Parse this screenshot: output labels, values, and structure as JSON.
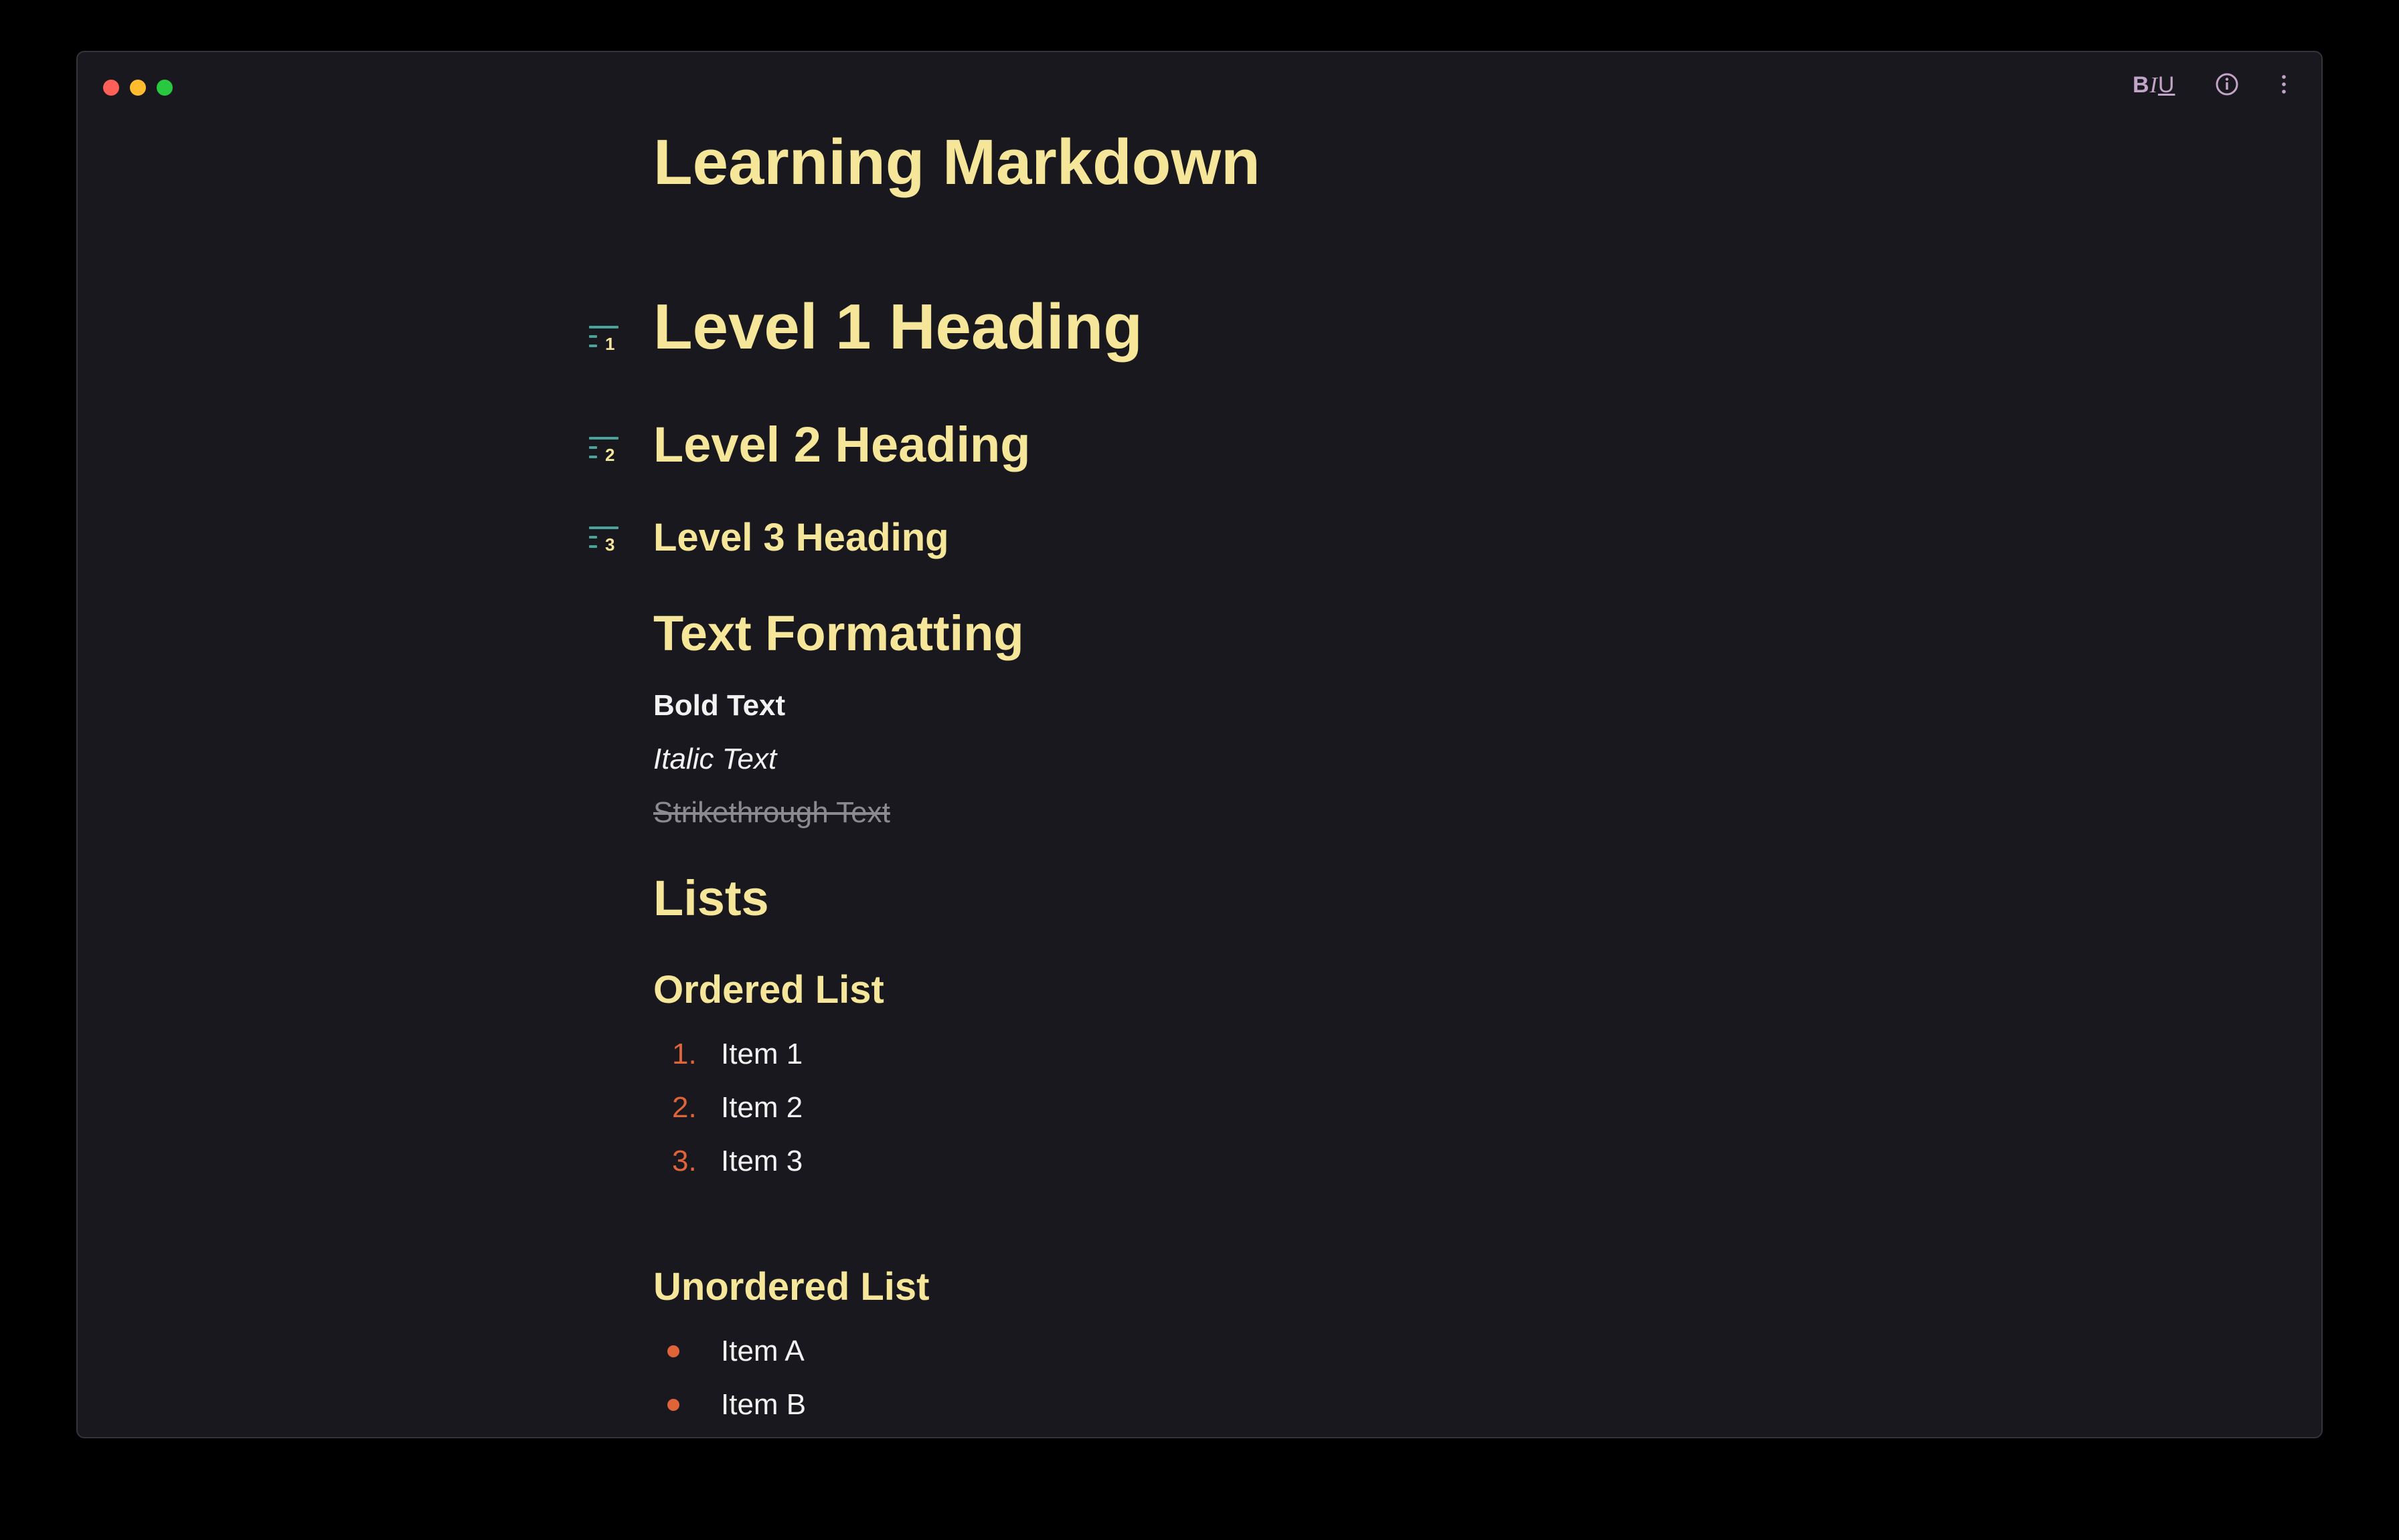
{
  "window": {
    "traffic_lights": [
      "close",
      "minimize",
      "maximize"
    ],
    "colors": {
      "background": "#18181e",
      "heading": "#f6e69a",
      "accent": "#e0643a",
      "marker": "#4aa39a"
    }
  },
  "toolbar": {
    "format_bold": "B",
    "format_italic": "I",
    "format_underline": "U",
    "info_icon": "info-icon",
    "more_icon": "more-vertical-icon"
  },
  "document": {
    "title": "Learning Markdown",
    "headings": [
      {
        "text": "Level 1 Heading",
        "marker": "1"
      },
      {
        "text": "Level 2 Heading",
        "marker": "2"
      },
      {
        "text": "Level 3 Heading",
        "marker": "3"
      }
    ],
    "formatting": {
      "heading": "Text Formatting",
      "bold": "Bold Text",
      "italic": "Italic Text",
      "strikethrough": "Strikethrough Text"
    },
    "lists": {
      "heading": "Lists",
      "ordered": {
        "heading": "Ordered List",
        "items": [
          {
            "num": "1.",
            "text": "Item 1"
          },
          {
            "num": "2.",
            "text": "Item 2"
          },
          {
            "num": "3.",
            "text": "Item 3"
          }
        ]
      },
      "unordered": {
        "heading": "Unordered List",
        "items": [
          "Item A",
          "Item B"
        ]
      }
    }
  }
}
